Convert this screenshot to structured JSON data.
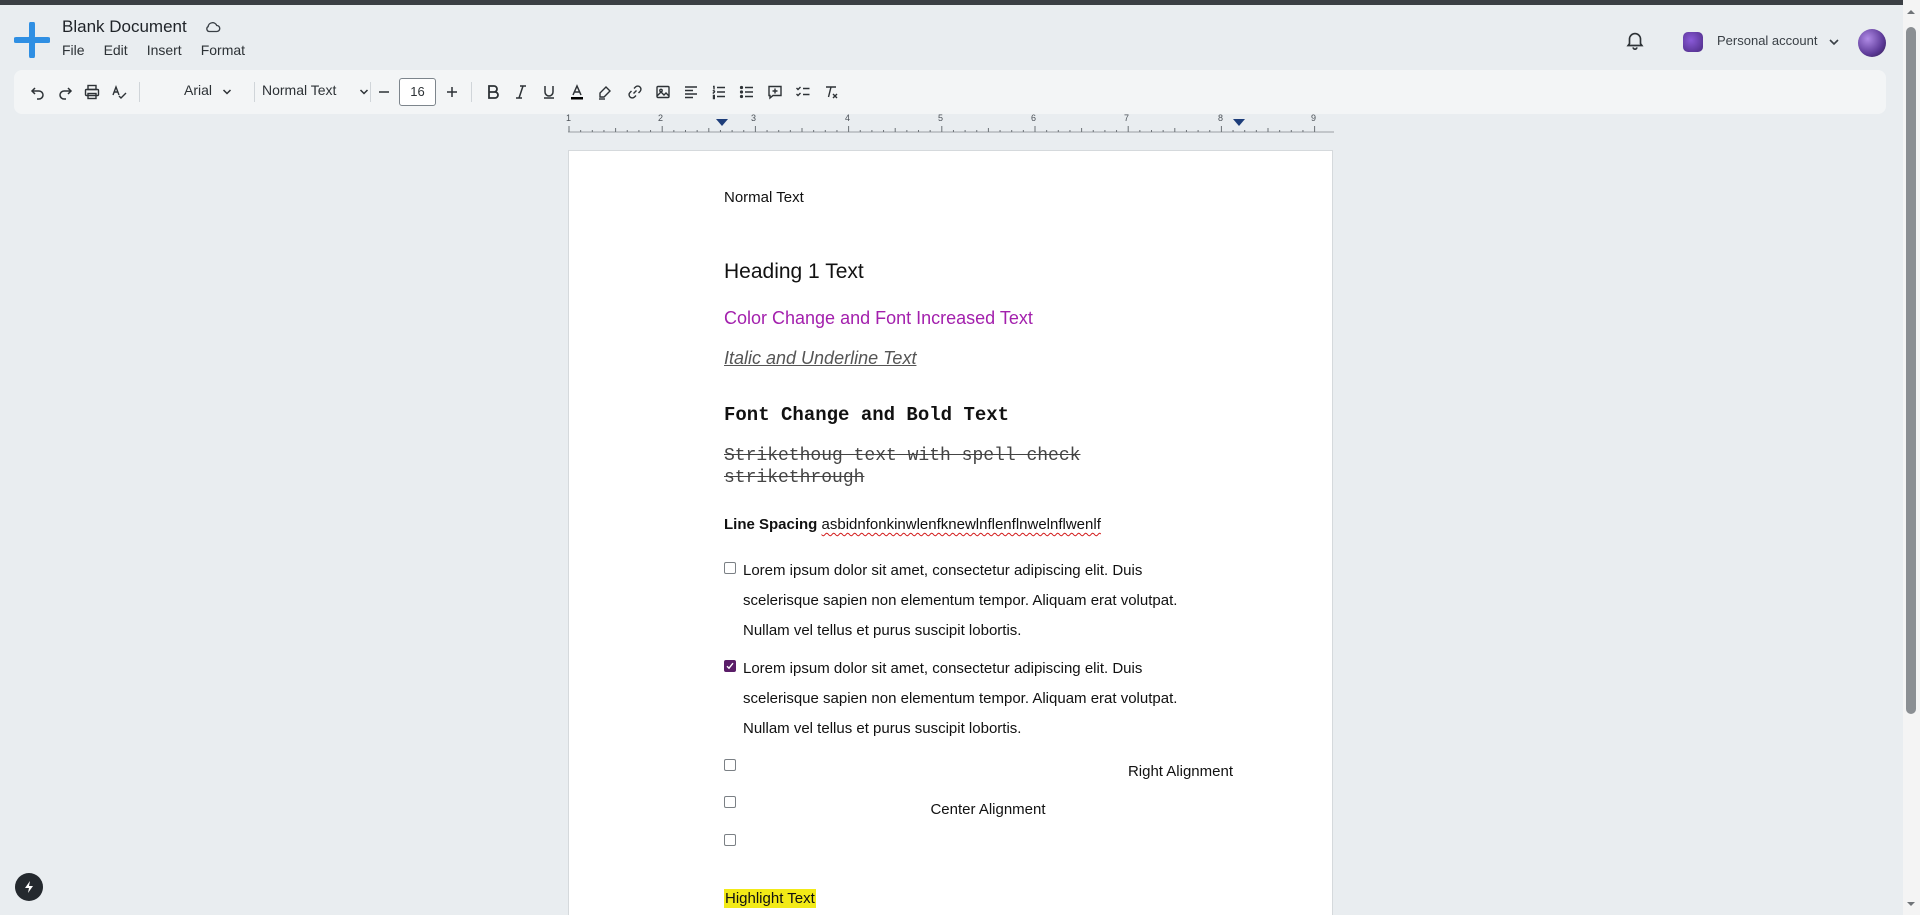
{
  "app": {
    "doc_title": "Blank Document",
    "menus": [
      "File",
      "Edit",
      "Insert",
      "Format"
    ],
    "account_label": "Personal account"
  },
  "toolbar": {
    "font": "Arial",
    "style": "Normal Text",
    "font_size": "16"
  },
  "ruler": {
    "numbers": [
      "1",
      "2",
      "3",
      "4",
      "5",
      "6",
      "7",
      "8",
      "9"
    ]
  },
  "document": {
    "normal": "Normal Text",
    "heading1": "Heading 1 Text",
    "colored": "Color Change and Font Increased Text",
    "italic_underline": "Italic and Underline Text",
    "font_bold": "Font Change and Bold Text",
    "strike": "Strikethoug text with spell check strikethrough",
    "line_spacing_label": "Line Spacing",
    "line_spacing_text": "asbidnfonkinwlenfknewlnflenflnwelnflwenlf",
    "para1_line1": "Lorem ipsum dolor sit amet, consectetur adipiscing elit. Duis",
    "para1_line2": "scelerisque sapien non elementum tempor. Aliquam erat volutpat.",
    "para1_line3": "Nullam vel tellus et purus suscipit lobortis.",
    "para2_line1": "Lorem ipsum dolor sit amet, consectetur adipiscing elit. Duis",
    "para2_line2": "scelerisque sapien non elementum tempor. Aliquam erat volutpat.",
    "para2_line3": "Nullam vel tellus et purus suscipit lobortis.",
    "right_alignment": "Right Alignment",
    "center_alignment": "Center Alignment",
    "highlight": "Highlight Text"
  },
  "colors": {
    "accent_text": "#a320ad",
    "highlight": "#f2ea17",
    "checkbox_checked": "#5a1d68",
    "logo": "#2f8fe3"
  },
  "icons": [
    "app-logo-icon",
    "cloud-icon",
    "bell-icon",
    "undo-icon",
    "redo-icon",
    "print-icon",
    "spellcheck-icon",
    "bold-icon",
    "italic-icon",
    "underline-icon",
    "text-color-icon",
    "highlighter-icon",
    "link-icon",
    "image-icon",
    "align-left-icon",
    "numbered-list-icon",
    "bulleted-list-icon",
    "comment-icon",
    "checklist-icon",
    "clear-format-icon",
    "bolt-icon"
  ]
}
